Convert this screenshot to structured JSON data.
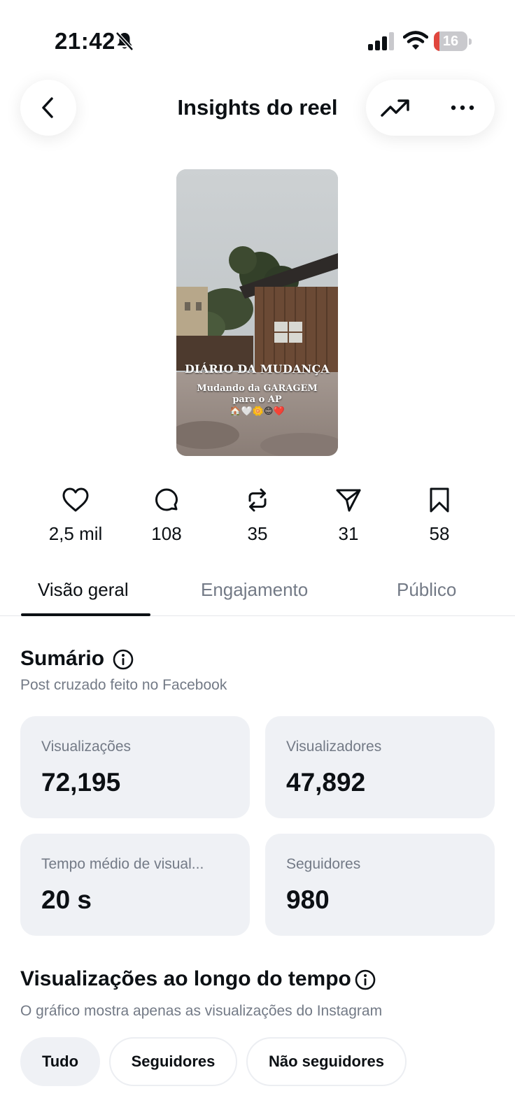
{
  "status_bar": {
    "time": "21:42",
    "battery": "16",
    "battery_level": 0.16
  },
  "header": {
    "title": "Insights do reel"
  },
  "reel": {
    "title": "DIÁRIO DA MUDANÇA",
    "subtitle_line1": "Mudando da GARAGEM",
    "subtitle_line2": "para o AP",
    "emoji": "🏠🤍🌼😊❤️"
  },
  "stats": {
    "likes": "2,5 mil",
    "comments": "108",
    "reposts": "35",
    "shares": "31",
    "saves": "58"
  },
  "tabs": [
    {
      "label": "Visão geral"
    },
    {
      "label": "Engajamento"
    },
    {
      "label": "Público"
    }
  ],
  "summary": {
    "title": "Sumário",
    "caption": "Post cruzado feito no Facebook",
    "cards": [
      {
        "label": "Visualizações",
        "value": "72,195"
      },
      {
        "label": "Visualizadores",
        "value": "47,892"
      },
      {
        "label": "Tempo médio de visual...",
        "value": "20 s"
      },
      {
        "label": "Seguidores",
        "value": "980"
      }
    ]
  },
  "views_over_time": {
    "title": "Visualizações ao longo do tempo",
    "caption": "O gráfico mostra apenas as visualizações do Instagram",
    "filters": [
      {
        "label": "Tudo"
      },
      {
        "label": "Seguidores"
      },
      {
        "label": "Não seguidores"
      }
    ]
  }
}
